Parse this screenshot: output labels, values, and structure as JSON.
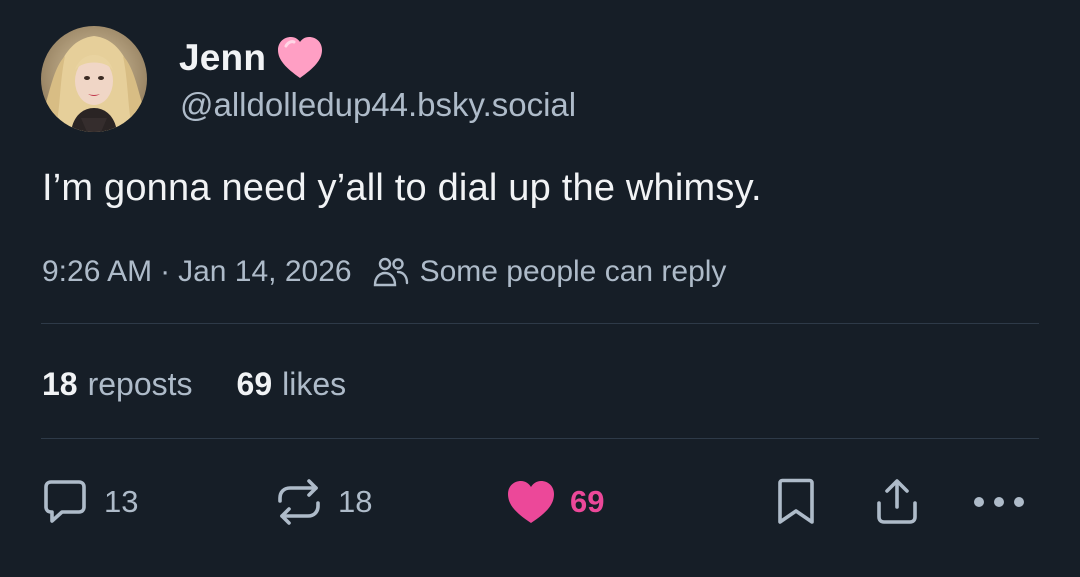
{
  "author": {
    "display_name": "Jenn",
    "name_emoji": "pink-heart-icon",
    "handle": "@alldolledup44.bsky.social"
  },
  "post": {
    "text": "I’m gonna need y’all to dial up the whimsy.",
    "time": "9:26 AM",
    "separator": "·",
    "date": "Jan 14, 2026",
    "reply_restriction": "Some people can reply"
  },
  "stats": {
    "reposts_count": "18",
    "reposts_label": "reposts",
    "likes_count": "69",
    "likes_label": "likes"
  },
  "actions": {
    "reply_count": "13",
    "repost_count": "18",
    "like_count": "69"
  },
  "colors": {
    "background": "#161e27",
    "text": "#f1f3f5",
    "muted": "#aebbc9",
    "like": "#ec4899",
    "heart_emoji": "#ff9fc4"
  }
}
